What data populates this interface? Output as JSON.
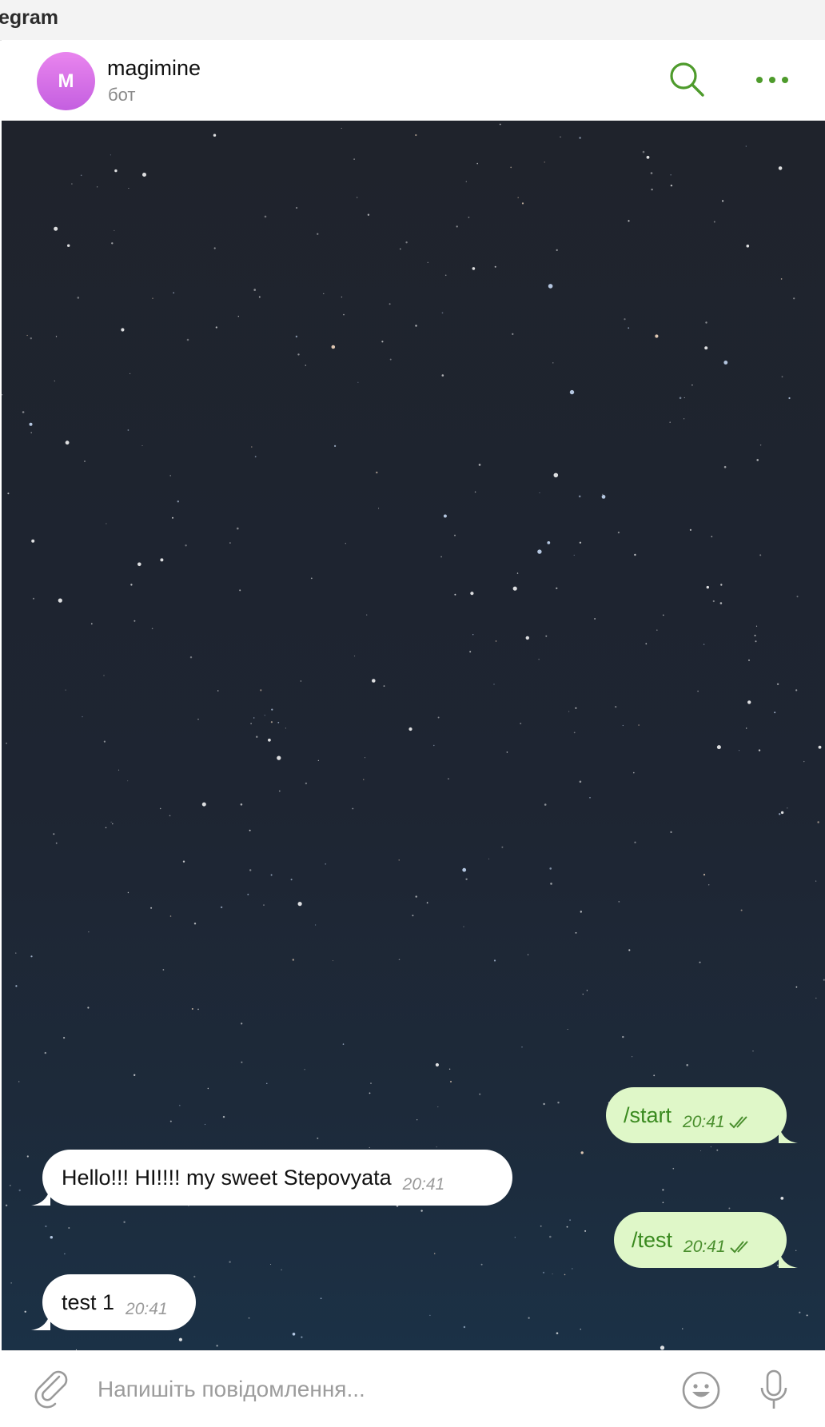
{
  "window": {
    "title": "egram"
  },
  "header": {
    "avatar_letter": "M",
    "avatar_color": "#d46ee8",
    "name": "magimine",
    "status": "бот",
    "accent_color": "#4e9b2c",
    "icons": [
      "search-icon",
      "more-icon"
    ]
  },
  "messages": [
    {
      "direction": "out",
      "text": "/start",
      "time": "20:41",
      "status": "read"
    },
    {
      "direction": "in",
      "text": "Hello!!! HI!!!! my sweet Stepovyata",
      "time": "20:41"
    },
    {
      "direction": "out",
      "text": "/test",
      "time": "20:41",
      "status": "read"
    },
    {
      "direction": "in",
      "text": "test 1",
      "time": "20:41"
    }
  ],
  "composer": {
    "placeholder": "Напишіть повідомлення...",
    "value": "",
    "icons": [
      "paperclip-icon",
      "emoji-icon",
      "microphone-icon"
    ]
  },
  "colors": {
    "outgoing_bubble": "#dff7c8",
    "incoming_bubble": "#ffffff",
    "outgoing_text": "#3a8a1f"
  }
}
